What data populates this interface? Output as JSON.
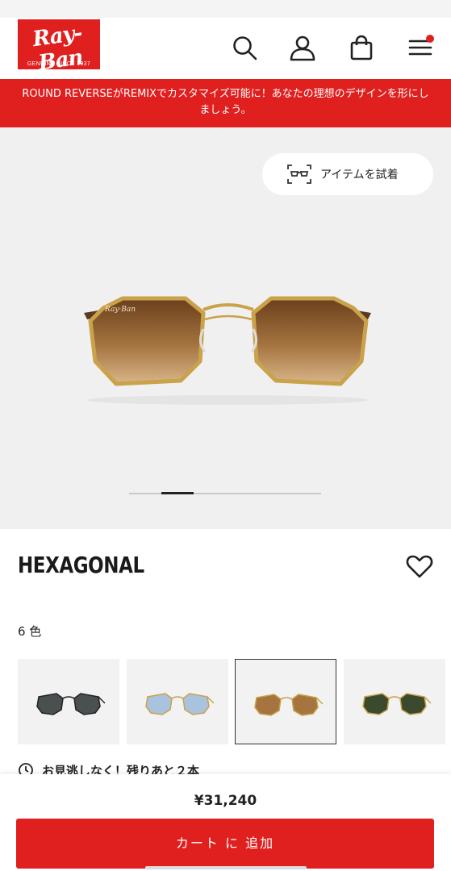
{
  "header": {
    "logo_text": "Ray-Ban",
    "logo_tagline": "GENUINE SINCE 1937",
    "icons": [
      "search-icon",
      "account-icon",
      "shopping-bag-icon",
      "menu-icon"
    ]
  },
  "promo": {
    "text": "ROUND REVERSEがREMIXでカスタマイズ可能に！あなたの理想のデザインを形にしましょう。"
  },
  "gallery": {
    "try_on_label": "アイテムを試着",
    "slide_count": 6,
    "current_slide": 2
  },
  "product": {
    "name": "HEXAGONAL",
    "colors_count_label": "6 色",
    "swatches": [
      "black-frame-grey-lens",
      "gold-frame-blue-lens",
      "gold-frame-brown-lens",
      "gold-frame-green-lens"
    ],
    "selected_swatch": 3,
    "stock_notice": "お見逃しなく！残りあと２本"
  },
  "footer": {
    "price": "¥31,240",
    "add_to_cart_label": "カート に 追加"
  },
  "colors": {
    "brand_red": "#e01f1f",
    "gallery_bg": "#f0f0f0"
  }
}
